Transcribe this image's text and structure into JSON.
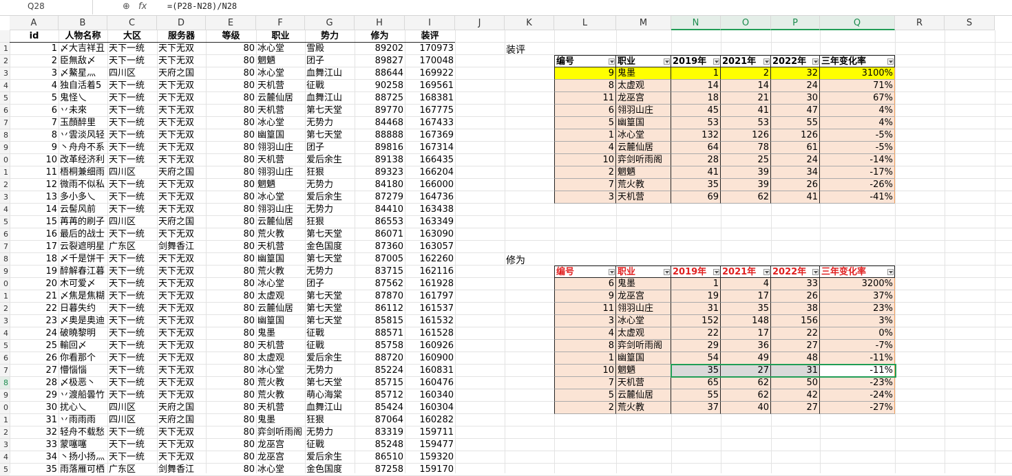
{
  "formula_bar": {
    "name_box": "Q28",
    "zoom_icon": "zoom-icon",
    "fx_label": "fx",
    "formula": "=(P28-N28)/N28"
  },
  "columns": [
    "A",
    "B",
    "C",
    "D",
    "E",
    "F",
    "G",
    "H",
    "I",
    "J",
    "K",
    "L",
    "M",
    "N",
    "O",
    "P",
    "Q",
    "R",
    "S"
  ],
  "main_table": {
    "headers": [
      "id",
      "人物名称",
      "大区",
      "服务器",
      "等级",
      "职业",
      "势力",
      "修为",
      "装评"
    ],
    "rows": [
      [
        "1",
        "〆大吉祥丑",
        "天下一统",
        "天下无双",
        "80",
        "冰心堂",
        "雪殿",
        "89202",
        "170973"
      ],
      [
        "2",
        "臣無敌〆",
        "天下一统",
        "天下无双",
        "80",
        "魍魉",
        "团子",
        "89827",
        "170048"
      ],
      [
        "3",
        "〆鰲星灬",
        "四川区",
        "天府之国",
        "80",
        "冰心堂",
        "血舞江山",
        "88644",
        "169922"
      ],
      [
        "4",
        "独自活着5",
        "天下一统",
        "天下无双",
        "80",
        "天机营",
        "征戰",
        "90258",
        "169561"
      ],
      [
        "5",
        "鬼怪乀",
        "天下一统",
        "天下无双",
        "80",
        "云麓仙居",
        "血舞江山",
        "88725",
        "168381"
      ],
      [
        "6",
        "丷未來",
        "天下一统",
        "天下无双",
        "80",
        "天机营",
        "第七天堂",
        "89770",
        "167775"
      ],
      [
        "7",
        "玉顏醉里",
        "天下一统",
        "天下无双",
        "80",
        "冰心堂",
        "无势力",
        "84468",
        "167433"
      ],
      [
        "8",
        "丷雲淡风轻",
        "天下一统",
        "天下无双",
        "80",
        "幽篁国",
        "第七天堂",
        "88888",
        "167369"
      ],
      [
        "9",
        "丶舟舟不系",
        "天下一统",
        "天下无双",
        "80",
        "翎羽山庄",
        "团子",
        "89816",
        "167314"
      ],
      [
        "10",
        "改革经济利",
        "天下一统",
        "天下无双",
        "80",
        "天机营",
        "爱后余生",
        "89138",
        "166435"
      ],
      [
        "11",
        "梧桐兼细雨",
        "四川区",
        "天府之国",
        "80",
        "翎羽山庄",
        "狂狠",
        "89323",
        "166204"
      ],
      [
        "12",
        "微雨不似私",
        "天下一统",
        "天下无双",
        "80",
        "魍魉",
        "无势力",
        "84180",
        "166000"
      ],
      [
        "13",
        "多小多乀",
        "天下一统",
        "天下无双",
        "80",
        "冰心堂",
        "爱后余生",
        "87279",
        "164736"
      ],
      [
        "14",
        "云髻风前",
        "天下一统",
        "天下无双",
        "80",
        "翎羽山庄",
        "无势力",
        "84410",
        "163438"
      ],
      [
        "15",
        "苒苒的刷子",
        "四川区",
        "天府之国",
        "80",
        "云麓仙居",
        "狂狠",
        "86553",
        "163349"
      ],
      [
        "16",
        "最后的战士",
        "天下一统",
        "天下无双",
        "80",
        "荒火教",
        "第七天堂",
        "86071",
        "163090"
      ],
      [
        "17",
        "云裂遮明星",
        "广东区",
        "剑舞香江",
        "80",
        "天机营",
        "金色国度",
        "87360",
        "163057"
      ],
      [
        "18",
        "〆千是饼干",
        "天下一统",
        "天下无双",
        "80",
        "幽篁国",
        "第七天堂",
        "87005",
        "162260"
      ],
      [
        "19",
        "醉解春江暮",
        "天下一统",
        "天下无双",
        "80",
        "荒火教",
        "无势力",
        "83715",
        "162116"
      ],
      [
        "20",
        "木可爱〆",
        "天下一统",
        "天下无双",
        "80",
        "冰心堂",
        "团子",
        "87562",
        "161928"
      ],
      [
        "21",
        "〆焦是焦糊",
        "天下一统",
        "天下无双",
        "80",
        "太虚观",
        "第七天堂",
        "87870",
        "161797"
      ],
      [
        "22",
        "日暮失约",
        "天下一统",
        "天下无双",
        "80",
        "云麓仙居",
        "第七天堂",
        "86112",
        "161537"
      ],
      [
        "23",
        "〆奥是奥迪",
        "天下一统",
        "天下无双",
        "80",
        "幽篁国",
        "第七天堂",
        "85815",
        "161532"
      ],
      [
        "24",
        "破曉黎明",
        "天下一统",
        "天下无双",
        "80",
        "鬼墨",
        "征戰",
        "88571",
        "161528"
      ],
      [
        "25",
        "輸回〆",
        "天下一统",
        "天下无双",
        "80",
        "天机营",
        "征戰",
        "85758",
        "160926"
      ],
      [
        "26",
        "你看那个",
        "天下一统",
        "天下无双",
        "80",
        "太虚观",
        "爱后余生",
        "88720",
        "160900"
      ],
      [
        "27",
        "懵惱惱",
        "天下一统",
        "天下无双",
        "80",
        "冰心堂",
        "无势力",
        "85224",
        "160831"
      ],
      [
        "28",
        "〆极恶丶",
        "天下一统",
        "天下无双",
        "80",
        "荒火教",
        "第七天堂",
        "85715",
        "160476"
      ],
      [
        "29",
        "丷渡船曇竹",
        "天下一统",
        "天下无双",
        "80",
        "荒火教",
        "萌心海棠",
        "85712",
        "160340"
      ],
      [
        "30",
        "扰心乀",
        "四川区",
        "天府之国",
        "80",
        "天机营",
        "血舞江山",
        "85424",
        "160304"
      ],
      [
        "31",
        "丷雨雨雨",
        "四川区",
        "天府之国",
        "80",
        "鬼墨",
        "狂狠",
        "87064",
        "160282"
      ],
      [
        "32",
        "轻舟不载愁",
        "天下一统",
        "天下无双",
        "80",
        "弈剑听雨阁",
        "无势力",
        "83319",
        "159711"
      ],
      [
        "33",
        "蒙噻噻",
        "天下一统",
        "天下无双",
        "80",
        "龙巫宫",
        "征戰",
        "85248",
        "159477"
      ],
      [
        "34",
        "丶扬小扬灬",
        "天下一统",
        "天下无双",
        "80",
        "龙巫宫",
        "爱后余生",
        "86510",
        "159320"
      ],
      [
        "35",
        "雨落雁可栖",
        "广东区",
        "剑舞香江",
        "80",
        "冰心堂",
        "金色国度",
        "87258",
        "159170"
      ]
    ]
  },
  "row_numbers": [
    "",
    "1",
    "2",
    "3",
    "4",
    "5",
    "6",
    "7",
    "8",
    "9",
    "0",
    "1",
    "2",
    "3",
    "4",
    "5",
    "6",
    "7",
    "8",
    "9",
    "0",
    "1",
    "2",
    "3",
    "4",
    "5",
    "6",
    "7",
    "8",
    "9",
    "0",
    "1",
    "2",
    "3",
    "4",
    "5",
    "6"
  ],
  "zhuangping": {
    "label": "装评",
    "headers": [
      "编号",
      "职业",
      "2019年",
      "2021年",
      "2022年",
      "三年变化率"
    ],
    "rows": [
      [
        "9",
        "鬼墨",
        "1",
        "2",
        "32",
        "3100%"
      ],
      [
        "8",
        "太虚观",
        "14",
        "14",
        "24",
        "71%"
      ],
      [
        "11",
        "龙巫宫",
        "18",
        "21",
        "30",
        "67%"
      ],
      [
        "6",
        "翎羽山庄",
        "45",
        "41",
        "47",
        "4%"
      ],
      [
        "5",
        "幽篁国",
        "53",
        "53",
        "55",
        "4%"
      ],
      [
        "1",
        "冰心堂",
        "132",
        "126",
        "126",
        "-5%"
      ],
      [
        "4",
        "云麓仙居",
        "64",
        "78",
        "61",
        "-5%"
      ],
      [
        "10",
        "弈剑听雨阁",
        "28",
        "25",
        "24",
        "-14%"
      ],
      [
        "2",
        "魍魉",
        "41",
        "39",
        "34",
        "-17%"
      ],
      [
        "7",
        "荒火教",
        "35",
        "39",
        "26",
        "-26%"
      ],
      [
        "3",
        "天机营",
        "69",
        "62",
        "41",
        "-41%"
      ]
    ]
  },
  "xiuwei": {
    "label": "修为",
    "headers": [
      "编号",
      "职业",
      "2019年",
      "2021年",
      "2022年",
      "三年变化率"
    ],
    "rows": [
      [
        "6",
        "鬼墨",
        "1",
        "4",
        "33",
        "3200%"
      ],
      [
        "9",
        "龙巫宫",
        "19",
        "17",
        "26",
        "37%"
      ],
      [
        "11",
        "翎羽山庄",
        "31",
        "35",
        "38",
        "23%"
      ],
      [
        "3",
        "冰心堂",
        "152",
        "148",
        "156",
        "3%"
      ],
      [
        "4",
        "太虚观",
        "22",
        "17",
        "22",
        "0%"
      ],
      [
        "8",
        "弈剑听雨阁",
        "29",
        "36",
        "27",
        "-7%"
      ],
      [
        "1",
        "幽篁国",
        "54",
        "49",
        "48",
        "-11%"
      ],
      [
        "10",
        "魍魉",
        "35",
        "27",
        "31",
        "-11%"
      ],
      [
        "7",
        "天机营",
        "65",
        "62",
        "50",
        "-23%"
      ],
      [
        "5",
        "云麓仙居",
        "55",
        "62",
        "42",
        "-24%"
      ],
      [
        "2",
        "荒火教",
        "37",
        "40",
        "27",
        "-27%"
      ]
    ]
  },
  "colors": {
    "selected_header": "#1f9d55",
    "pink_fill": "#fbe4d5",
    "yellow_fill": "#ffff00",
    "red_header": "#e02020"
  }
}
